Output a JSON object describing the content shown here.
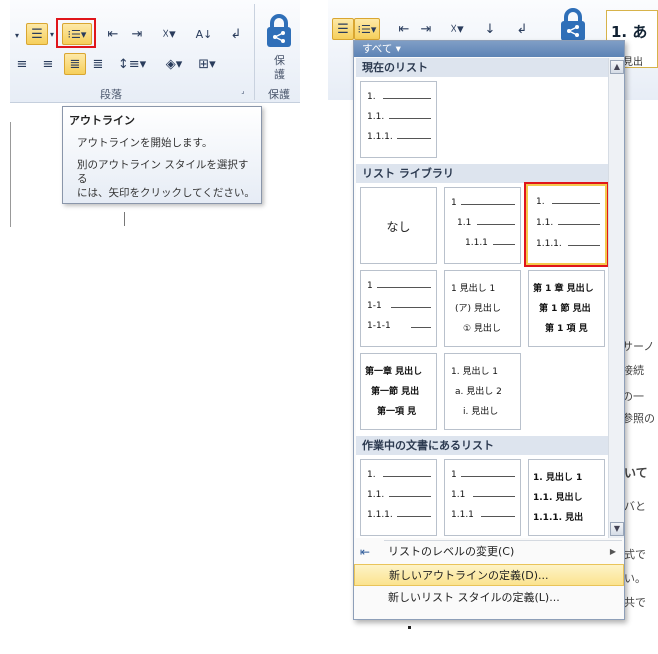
{
  "left": {
    "ribbon": {
      "group_label": "段落",
      "protect_label": "保護",
      "protect_btn": [
        "保",
        "護"
      ]
    },
    "tooltip": {
      "title": "アウトライン",
      "line1": "アウトラインを開始します。",
      "line2a": "別のアウトライン スタイルを選択する",
      "line2b": "には、矢印をクリックしてください。"
    }
  },
  "right": {
    "doc_fragments": {
      "heading": "1. あ",
      "tab_label": "見出",
      "f1": "サーノ",
      "f2": "接続",
      "f3": "の一",
      "f4": "参照の",
      "f5": "いて",
      "f6": "バと",
      "f7": "式で",
      "f8": "い。",
      "f9": "共で"
    },
    "dropdown": {
      "header": "すべて ▾",
      "sections": {
        "current": "現在のリスト",
        "library": "リスト ライブラリ",
        "in_doc": "作業中の文書にあるリスト"
      },
      "tiles": {
        "current": {
          "l1": "1.",
          "l2": "1.1.",
          "l3": "1.1.1."
        },
        "none_label": "なし",
        "lib2": {
          "l1": "1",
          "l2": "1.1",
          "l3": "1.1.1"
        },
        "lib3": {
          "l1": "1.",
          "l2": "1.1.",
          "l3": "1.1.1."
        },
        "lib4": {
          "l1": "1",
          "l2": "1-1",
          "l3": "1-1-1"
        },
        "lib5": {
          "l1": "1 見出し 1",
          "l2": "(ア) 見出し",
          "l3": "① 見出し"
        },
        "lib6": {
          "l1": "第 1 章 見出し",
          "l2": "第 1 節 見出",
          "l3": "第 1 項 見"
        },
        "lib7": {
          "l1": "第一章 見出し",
          "l2": "第一節 見出",
          "l3": "第一項 見"
        },
        "lib8": {
          "l1": "1. 見出し 1",
          "l2": "a. 見出し 2",
          "l3": "i. 見出し"
        },
        "doc1": {
          "l1": "1.",
          "l2": "1.1.",
          "l3": "1.1.1."
        },
        "doc2": {
          "l1": "1",
          "l2": "1.1",
          "l3": "1.1.1"
        },
        "doc3": {
          "l1": "1. 見出し 1",
          "l2": "1.1. 見出し",
          "l3": "1.1.1. 見出"
        }
      },
      "menu": {
        "change_level": "リストのレベルの変更(C)",
        "new_outline": "新しいアウトラインの定義(D)...",
        "new_list_style": "新しいリスト スタイルの定義(L)..."
      }
    }
  }
}
